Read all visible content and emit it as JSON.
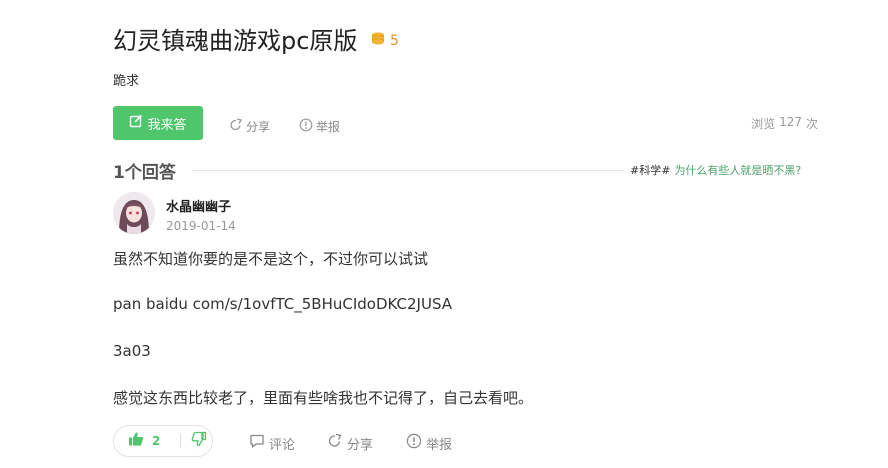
{
  "question": {
    "title": "幻灵镇魂曲游戏pc原版",
    "reward": "5",
    "description": "跪求"
  },
  "toolbar": {
    "answer_label": "我来答",
    "share_label": "分享",
    "report_label": "举报",
    "views_label": "浏览",
    "views_count": "127",
    "views_unit": "次"
  },
  "answers_header": {
    "count_label": "1个回答",
    "topic_tag": "#科学#",
    "topic_link": "为什么有些人就是晒不黑?"
  },
  "answer": {
    "username": "水晶幽幽子",
    "date": "2019-01-14",
    "paragraphs": [
      "虽然不知道你要的是不是这个，不过你可以试试",
      "pan baidu com/s/1ovfTC_5BHuCIdoDKC2JUSA",
      "3a03",
      "感觉这东西比较老了，里面有些啥我也不记得了，自己去看吧。"
    ],
    "likes": "2",
    "comment_label": "评论",
    "share_label": "分享",
    "report_label": "举报"
  },
  "colors": {
    "accent_green": "#4fc66b",
    "coin_orange": "#e2902b",
    "topic_green": "#4aa36a"
  }
}
